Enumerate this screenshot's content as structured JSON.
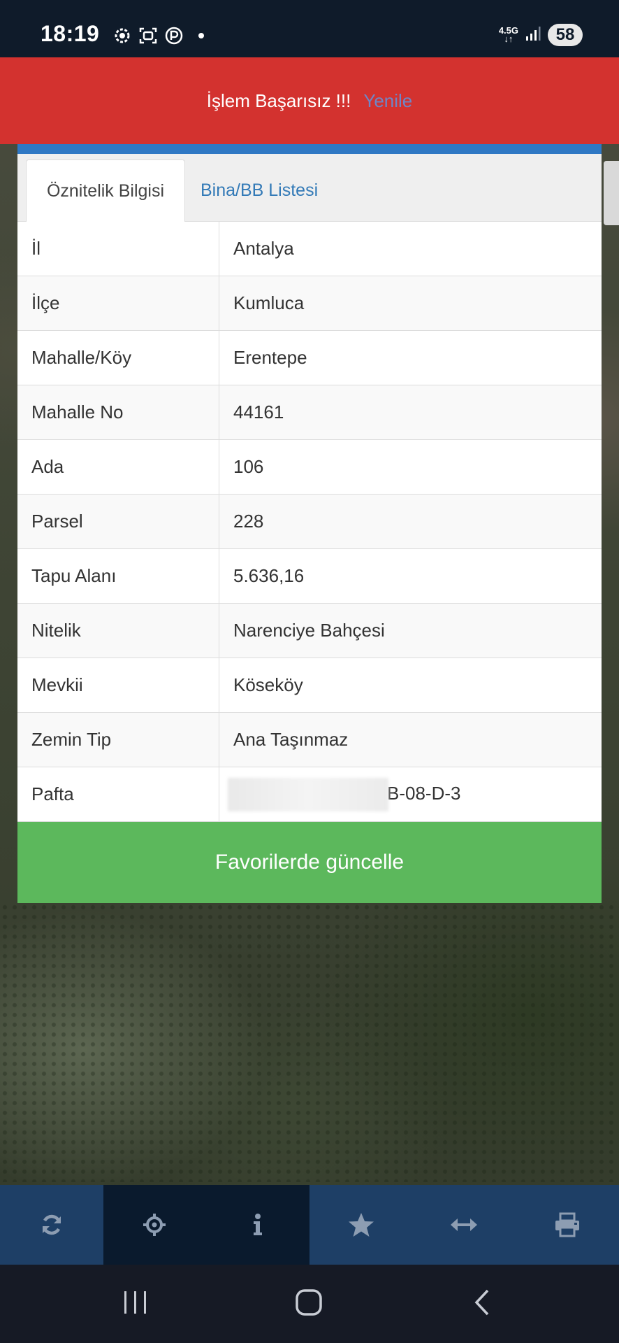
{
  "status_bar": {
    "time": "18:19",
    "network_type_top": "4.5G",
    "network_type_bottom": "↓↑",
    "battery": "58"
  },
  "banner": {
    "error_text": "İşlem Başarısız !!!",
    "retry_label": "Yenile"
  },
  "tabs": {
    "attributes_label": "Öznitelik Bilgisi",
    "buildings_label": "Bina/BB Listesi"
  },
  "attributes": [
    {
      "key": "İl",
      "value": "Antalya"
    },
    {
      "key": "İlçe",
      "value": "Kumluca"
    },
    {
      "key": "Mahalle/Köy",
      "value": "Erentepe"
    },
    {
      "key": "Mahalle No",
      "value": "44161"
    },
    {
      "key": "Ada",
      "value": "106"
    },
    {
      "key": "Parsel",
      "value": "228"
    },
    {
      "key": "Tapu Alanı",
      "value": "5.636,16"
    },
    {
      "key": "Nitelik",
      "value": "Narenciye Bahçesi"
    },
    {
      "key": "Mevkii",
      "value": "Köseköy"
    },
    {
      "key": "Zemin Tip",
      "value": "Ana Taşınmaz"
    },
    {
      "key": "Pafta",
      "value": "B-08-D-3"
    }
  ],
  "update_button_label": "Favorilerde güncelle",
  "toolbar": {
    "icons": [
      "refresh-icon",
      "crosshair-icon",
      "info-icon",
      "star-icon",
      "measure-icon",
      "print-icon"
    ],
    "active_index": [
      1,
      2
    ]
  },
  "colors": {
    "banner_bg": "#d3322f",
    "retry_link": "#6f86c7",
    "panel_accent": "#2f78c4",
    "tab_link": "#337ab7",
    "update_button_bg": "#5cb85c",
    "toolbar_bg": "#1e3f66",
    "toolbar_active_bg": "#0a1a2d",
    "toolbar_icon": "#8d9db2"
  }
}
